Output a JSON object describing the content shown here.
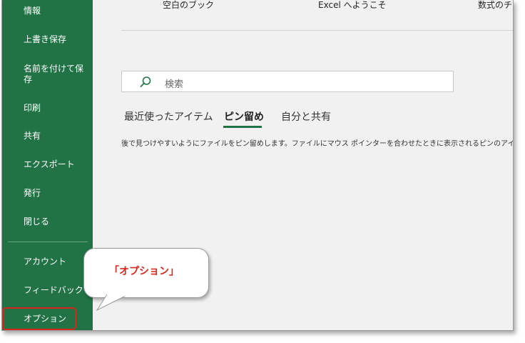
{
  "sidebar": {
    "items": [
      {
        "label": "情報"
      },
      {
        "label": "上書き保存"
      },
      {
        "label": "名前を付けて保\n存"
      },
      {
        "label": "印刷"
      },
      {
        "label": "共有"
      },
      {
        "label": "エクスポート"
      },
      {
        "label": "発行"
      },
      {
        "label": "閉じる"
      },
      {
        "label": "アカウント"
      },
      {
        "label": "フィードバック"
      },
      {
        "label": "オプション"
      }
    ]
  },
  "templates": {
    "blank_workbook": "空白のブック",
    "welcome": "Excel へようこそ",
    "formula": "数式のチュ"
  },
  "search": {
    "icon": "search-icon",
    "placeholder": "検索"
  },
  "tabs": {
    "recent": "最近使ったアイテム",
    "pinned": "ピン留め",
    "shared": "自分と共有"
  },
  "pinned_description": "後で見つけやすいようにファイルをピン留めします。ファイルにマウス ポインターを合わせたときに表示されるピンのアイコンをク",
  "callout": {
    "text": "「オプション」"
  },
  "colors": {
    "sidebar": "#217346",
    "accent": "#217346",
    "highlight": "#d9261c"
  }
}
